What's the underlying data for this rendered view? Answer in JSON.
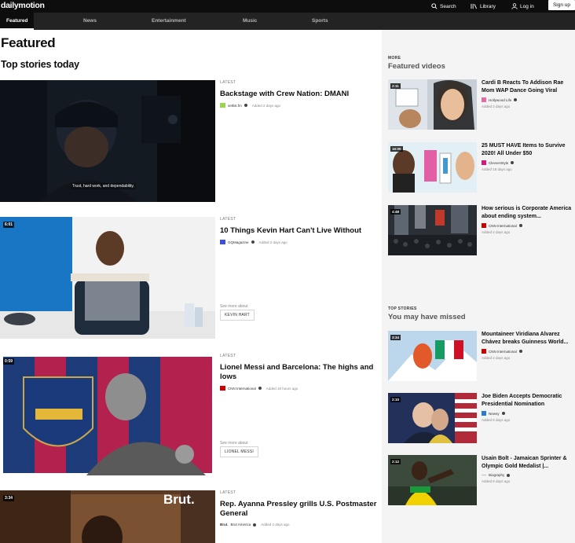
{
  "header": {
    "logo": "dailymotion",
    "search_label": "Search",
    "library_label": "Library",
    "login_label": "Log in",
    "signup_label": "Sign up"
  },
  "nav": {
    "items": [
      {
        "label": "Featured",
        "active": true
      },
      {
        "label": "News"
      },
      {
        "label": "Entertainment"
      },
      {
        "label": "Music"
      },
      {
        "label": "Sports"
      }
    ]
  },
  "main": {
    "heading": "Featured",
    "subheading": "Top stories today",
    "stories": [
      {
        "kicker": "LATEST",
        "title": "Backstage with Crew Nation: DMANI",
        "channel": "setlist.fm",
        "added": "Added 2 days ago",
        "duration": "",
        "caption": "Trust, hard work, and dependability."
      },
      {
        "kicker": "LATEST",
        "title": "10 Things Kevin Hart Can't Live Without",
        "channel": "GQMagazine",
        "added": "Added 2 days ago",
        "duration": "6:01",
        "see_more": "See more about",
        "tag": "KEVIN HART"
      },
      {
        "kicker": "LATEST",
        "title": "Lionel Messi and Barcelona: The highs and lows",
        "channel": "CNN International",
        "added": "Added 18 hours ago",
        "duration": "0:59",
        "see_more": "See more about",
        "tag": "LIONEL MESSI"
      },
      {
        "kicker": "LATEST",
        "title": "Rep. Ayanna Pressley grills U.S. Postmaster General",
        "channel": "Brut America",
        "added": "Added 2 days ago",
        "duration": "3:34",
        "brand": "Brut."
      }
    ]
  },
  "sidebar": {
    "featured": {
      "kicker": "MORE",
      "heading": "Featured videos",
      "items": [
        {
          "duration": "2:11",
          "title": "Cardi B Reacts To Addison Rae Mom WAP Dance Going Viral",
          "channel": "Hollywood Life",
          "added": "Added 2 days ago"
        },
        {
          "duration": "16:00",
          "title": "25 MUST HAVE Items to Survive 2020! All Under $50",
          "channel": "ClevverStyle",
          "added": "Added 18 days ago"
        },
        {
          "duration": "4:48",
          "title": "How serious is Corporate America about ending system...",
          "channel": "CNN International",
          "added": "Added 2 days ago"
        }
      ]
    },
    "missed": {
      "kicker": "TOP STORIES",
      "heading": "You may have missed",
      "items": [
        {
          "duration": "3:34",
          "title": "Mountaineer Viridiana Alvarez Chávez breaks Guinness World...",
          "channel": "CNN International",
          "added": "Added 2 days ago"
        },
        {
          "duration": "2:10",
          "title": "Joe Biden Accepts Democratic Presidential Nomination",
          "channel": "Newsy",
          "added": "Added 6 days ago"
        },
        {
          "duration": "2:12",
          "title": "Usain Bolt - Jamaican Sprinter & Olympic Gold Medalist |...",
          "channel": "Biography",
          "added": "Added 6 days ago"
        }
      ]
    }
  }
}
